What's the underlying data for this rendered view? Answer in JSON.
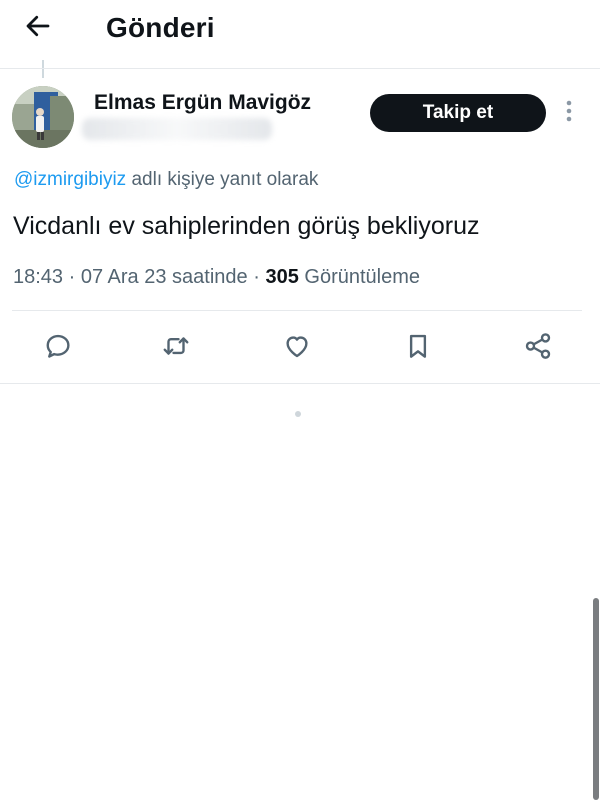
{
  "header": {
    "title": "Gönderi",
    "back_icon": "arrow-left-icon"
  },
  "post": {
    "author_name": "Elmas Ergün Mavigöz",
    "follow_label": "Takip et",
    "more_icon": "more-vertical-icon",
    "reply_mention": "@izmirgibiyiz",
    "reply_suffix": "adlı kişiye yanıt olarak",
    "text": "Vicdanlı ev sahiplerinden görüş bekliyoruz",
    "time": "18:43",
    "separator": "·",
    "date_label": "07 Ara 23 saatinde",
    "views_count": "305",
    "views_label": "Görüntüleme"
  },
  "actions": {
    "icons": [
      "reply-icon",
      "repost-icon",
      "like-icon",
      "bookmark-icon",
      "share-icon"
    ]
  },
  "colors": {
    "text_primary": "#0f1419",
    "text_secondary": "#536471",
    "link": "#1d9bf0",
    "button_bg": "#0f1419"
  }
}
